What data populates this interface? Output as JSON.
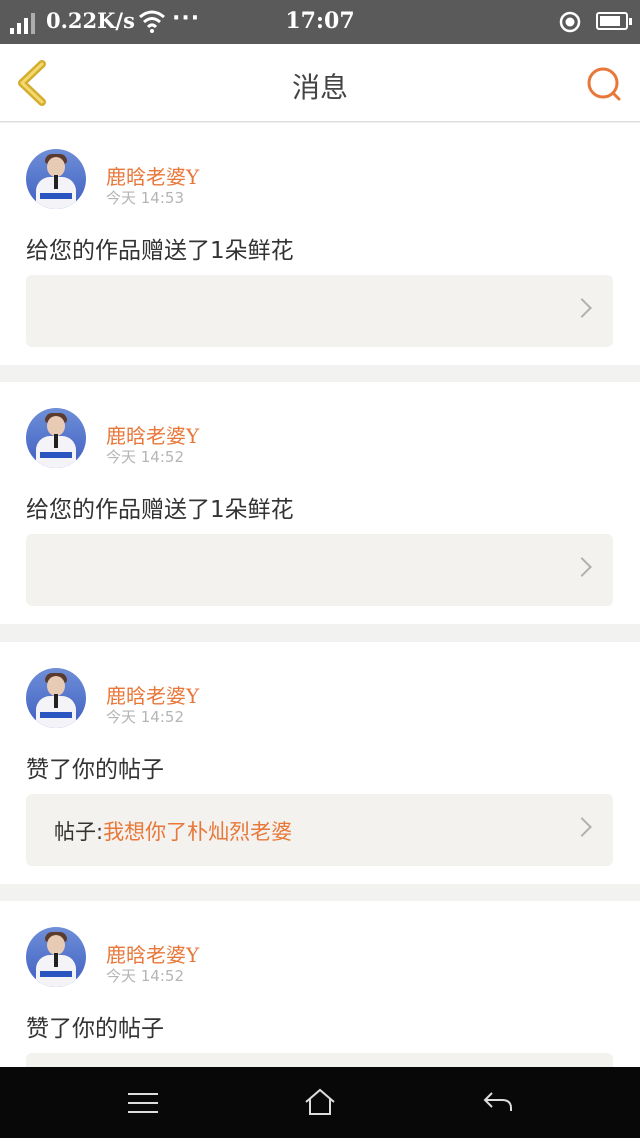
{
  "status_bar": {
    "network_speed": "0.22K/s",
    "dots": "···",
    "time": "17:07",
    "battery_level": 0.85
  },
  "header": {
    "title": "消息"
  },
  "colors": {
    "accent": "#e8773a",
    "back_arrow": "#e8c64a"
  },
  "messages": [
    {
      "username": "鹿晗老婆Y",
      "timestamp": "今天 14:53",
      "action": "给您的作品赠送了1朵鲜花",
      "ref_label": "",
      "ref_link": ""
    },
    {
      "username": "鹿晗老婆Y",
      "timestamp": "今天 14:52",
      "action": "给您的作品赠送了1朵鲜花",
      "ref_label": "",
      "ref_link": ""
    },
    {
      "username": "鹿晗老婆Y",
      "timestamp": "今天 14:52",
      "action": "赞了你的帖子",
      "ref_label": "帖子:",
      "ref_link": "我想你了朴灿烈老婆"
    },
    {
      "username": "鹿晗老婆Y",
      "timestamp": "今天 14:52",
      "action": "赞了你的帖子",
      "ref_label": "",
      "ref_link": ""
    }
  ],
  "bottom_nav": {
    "icons": [
      "menu-icon",
      "home-icon",
      "back-icon"
    ]
  }
}
